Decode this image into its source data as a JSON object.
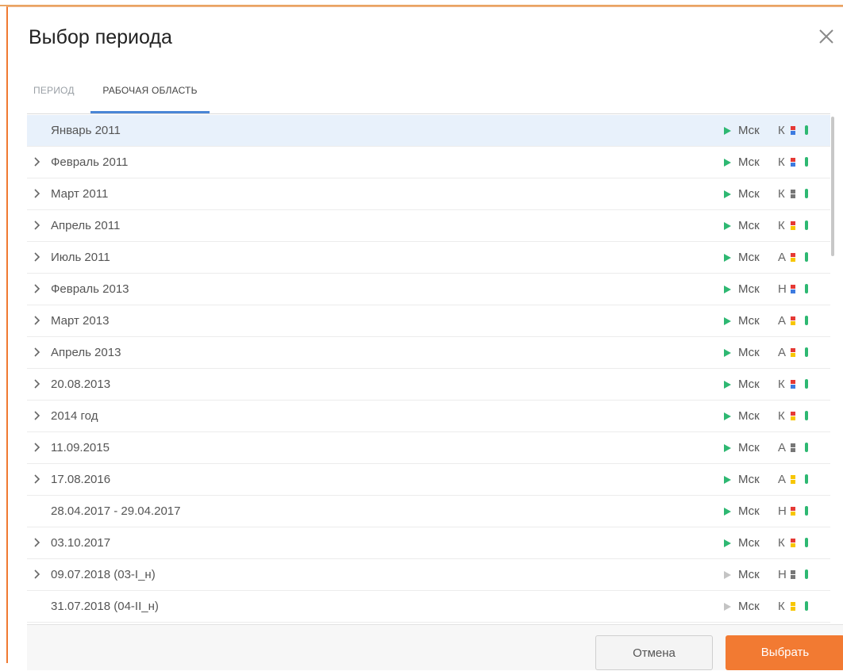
{
  "dialog": {
    "title": "Выбор периода"
  },
  "tabs": [
    {
      "label": "ПЕРИОД",
      "active": false
    },
    {
      "label": "РАБОЧАЯ ОБЛАСТЬ",
      "active": true
    }
  ],
  "colors": {
    "accent": "#f27a32",
    "tab_underline": "#4a86d6",
    "play_active": "#2eb872",
    "play_inactive": "#c4c4c4",
    "status_dot": "#2eb872",
    "red": "#e53935",
    "blue": "#3d7be0",
    "yellow": "#f7c600",
    "gray": "#777777"
  },
  "rows": [
    {
      "label": "Январь 2011",
      "expandable": false,
      "selected": true,
      "play_active": true,
      "tz": "Мск",
      "letter": "К",
      "flag": [
        "red",
        "blue"
      ]
    },
    {
      "label": "Февраль 2011",
      "expandable": true,
      "play_active": true,
      "tz": "Мск",
      "letter": "К",
      "flag": [
        "red",
        "blue"
      ]
    },
    {
      "label": "Март 2011",
      "expandable": true,
      "play_active": true,
      "tz": "Мск",
      "letter": "К",
      "flag": [
        "gray",
        "gray"
      ]
    },
    {
      "label": "Апрель 2011",
      "expandable": true,
      "play_active": true,
      "tz": "Мск",
      "letter": "К",
      "flag": [
        "red",
        "yellow"
      ]
    },
    {
      "label": "Июль 2011",
      "expandable": true,
      "play_active": true,
      "tz": "Мск",
      "letter": "А",
      "flag": [
        "red",
        "yellow"
      ]
    },
    {
      "label": "Февраль 2013",
      "expandable": true,
      "play_active": true,
      "tz": "Мск",
      "letter": "Н",
      "flag": [
        "red",
        "blue"
      ]
    },
    {
      "label": "Март 2013",
      "expandable": true,
      "play_active": true,
      "tz": "Мск",
      "letter": "А",
      "flag": [
        "red",
        "yellow"
      ]
    },
    {
      "label": "Апрель 2013",
      "expandable": true,
      "play_active": true,
      "tz": "Мск",
      "letter": "А",
      "flag": [
        "red",
        "yellow"
      ]
    },
    {
      "label": "20.08.2013",
      "expandable": true,
      "play_active": true,
      "tz": "Мск",
      "letter": "К",
      "flag": [
        "red",
        "blue"
      ]
    },
    {
      "label": "2014 год",
      "expandable": true,
      "play_active": true,
      "tz": "Мск",
      "letter": "К",
      "flag": [
        "red",
        "yellow"
      ]
    },
    {
      "label": "11.09.2015",
      "expandable": true,
      "play_active": true,
      "tz": "Мск",
      "letter": "А",
      "flag": [
        "gray",
        "gray"
      ]
    },
    {
      "label": "17.08.2016",
      "expandable": true,
      "play_active": true,
      "tz": "Мск",
      "letter": "А",
      "flag": [
        "yellow",
        "yellow"
      ]
    },
    {
      "label": "28.04.2017 - 29.04.2017",
      "expandable": false,
      "play_active": true,
      "tz": "Мск",
      "letter": "Н",
      "flag": [
        "red",
        "yellow"
      ]
    },
    {
      "label": "03.10.2017",
      "expandable": true,
      "play_active": true,
      "tz": "Мск",
      "letter": "К",
      "flag": [
        "red",
        "yellow"
      ]
    },
    {
      "label": "09.07.2018 (03-I_н)",
      "expandable": true,
      "play_active": false,
      "tz": "Мск",
      "letter": "Н",
      "flag": [
        "gray",
        "gray"
      ]
    },
    {
      "label": "31.07.2018 (04-II_н)",
      "expandable": false,
      "play_active": false,
      "tz": "Мск",
      "letter": "К",
      "flag": [
        "yellow",
        "yellow"
      ]
    }
  ],
  "footer": {
    "cancel_label": "Отмена",
    "ok_label": "Выбрать"
  }
}
